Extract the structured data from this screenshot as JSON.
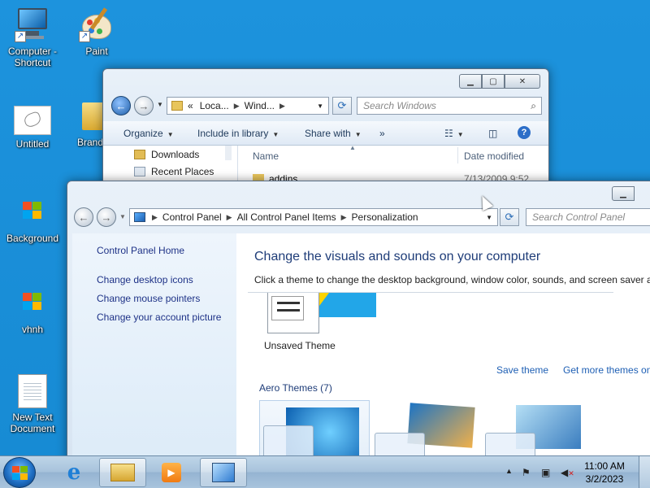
{
  "desktop": {
    "icons": [
      {
        "label": "Computer - Shortcut",
        "icon": "computer-icon"
      },
      {
        "label": "Paint",
        "icon": "paint-icon"
      },
      {
        "label": "Untitled",
        "icon": "image-icon"
      },
      {
        "label": "Brand",
        "icon": "folder-icon"
      },
      {
        "label": "Background",
        "icon": "windows-logo-icon"
      },
      {
        "label": "vhnh",
        "icon": "windows-logo-icon"
      },
      {
        "label": "New Text Document",
        "icon": "text-document-icon"
      }
    ]
  },
  "explorer": {
    "address_prefix": "«",
    "address_segments": [
      "Loca...",
      "Wind..."
    ],
    "search_placeholder": "Search Windows",
    "toolbar": {
      "organize": "Organize",
      "include_in_library": "Include in library",
      "share_with": "Share with",
      "more": "»"
    },
    "nav_items": [
      "Downloads",
      "Recent Places"
    ],
    "columns": {
      "name": "Name",
      "date_modified": "Date modified"
    },
    "rows": [
      {
        "name": "addins",
        "date_modified": "7/13/2009 9:52"
      }
    ]
  },
  "control_panel": {
    "address_segments": [
      "Control Panel",
      "All Control Panel Items",
      "Personalization"
    ],
    "search_placeholder": "Search Control Panel",
    "sidebar": {
      "home": "Control Panel Home",
      "links": [
        "Change desktop icons",
        "Change mouse pointers",
        "Change your account picture"
      ]
    },
    "main": {
      "heading": "Change the visuals and sounds on your computer",
      "description": "Click a theme to change the desktop background, window color, sounds, and screen saver al",
      "unsaved_theme": "Unsaved Theme",
      "save_theme": "Save theme",
      "get_more_themes": "Get more themes on",
      "aero_themes": "Aero Themes (7)"
    }
  },
  "taskbar": {
    "pinned": [
      "internet-explorer-icon",
      "windows-explorer-icon",
      "media-player-icon",
      "control-panel-icon"
    ],
    "time": "11:00 AM",
    "date": "3/2/2023"
  },
  "colors": {
    "desktop": "#1d93dd",
    "link": "#1e3287",
    "heading": "#1e3c78"
  }
}
